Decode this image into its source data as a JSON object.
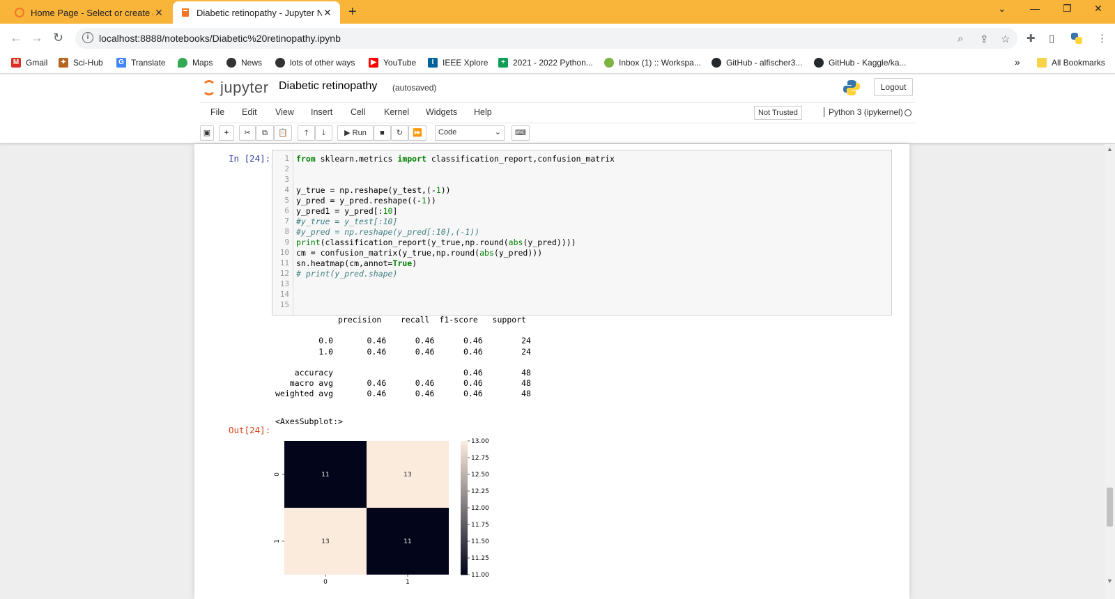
{
  "browser": {
    "tabs": [
      {
        "title": "Home Page - Select or create a n",
        "active": false
      },
      {
        "title": "Diabetic retinopathy - Jupyter N",
        "active": true
      }
    ],
    "new_tab": "+",
    "url": "localhost:8888/notebooks/Diabetic%20retinopathy.ipynb",
    "bookmarks": [
      {
        "label": "Gmail",
        "icon": "gmail-icon",
        "color": "#d93025"
      },
      {
        "label": "Sci-Hub",
        "icon": "scihub-icon",
        "color": "#b5651d"
      },
      {
        "label": "Translate",
        "icon": "translate-icon",
        "color": "#4285f4"
      },
      {
        "label": "Maps",
        "icon": "maps-icon",
        "color": "#34a853"
      },
      {
        "label": "News",
        "icon": "globe-icon",
        "color": "#333333"
      },
      {
        "label": "lots of other ways",
        "icon": "globe-icon",
        "color": "#333333"
      },
      {
        "label": "YouTube",
        "icon": "youtube-icon",
        "color": "#ff0000"
      },
      {
        "label": "IEEE Xplore",
        "icon": "ieee-icon",
        "color": "#00629b"
      },
      {
        "label": "2021 - 2022 Python...",
        "icon": "sheets-icon",
        "color": "#0f9d58"
      },
      {
        "label": "Inbox (1) :: Workspa...",
        "icon": "inbox-icon",
        "color": "#7cb342"
      },
      {
        "label": "GitHub - alfischer3...",
        "icon": "github-icon",
        "color": "#24292e"
      },
      {
        "label": "GitHub - Kaggle/ka...",
        "icon": "github-icon",
        "color": "#24292e"
      }
    ],
    "more_bookmarks": "»",
    "all_bookmarks": "All Bookmarks"
  },
  "jupyter": {
    "logo_text": "jupyter",
    "notebook_name": "Diabetic retinopathy",
    "autosave": "(autosaved)",
    "logout": "Logout",
    "menu": [
      "File",
      "Edit",
      "View",
      "Insert",
      "Cell",
      "Kernel",
      "Widgets",
      "Help"
    ],
    "trust": "Not Trusted",
    "kernel": "Python 3 (ipykernel)",
    "run_label": "Run",
    "cell_type": "Code"
  },
  "cell": {
    "in_prompt": "In [24]:",
    "out_prompt": "Out[24]:",
    "line_numbers": [
      "1",
      "2",
      "3",
      "4",
      "5",
      "6",
      "7",
      "8",
      "9",
      "10",
      "11",
      "12",
      "13",
      "14",
      "15"
    ],
    "output_report": "             precision    recall  f1-score   support\n\n         0.0       0.46      0.46      0.46        24\n         1.0       0.46      0.46      0.46        24\n\n    accuracy                           0.46        48\n   macro avg       0.46      0.46      0.46        48\nweighted avg       0.46      0.46      0.46        48",
    "output_repr": "<AxesSubplot:>"
  },
  "chart_data": {
    "type": "heatmap",
    "matrix": [
      [
        11,
        13
      ],
      [
        13,
        11
      ]
    ],
    "x_ticks": [
      "0",
      "1"
    ],
    "y_ticks": [
      "0",
      "1"
    ],
    "colorbar_ticks": [
      "13.00",
      "12.75",
      "12.50",
      "12.25",
      "12.00",
      "11.75",
      "11.50",
      "11.25",
      "11.00"
    ],
    "vmin": 11,
    "vmax": 13,
    "colors": {
      "low": "#03051a",
      "high": "#faebdd"
    }
  }
}
